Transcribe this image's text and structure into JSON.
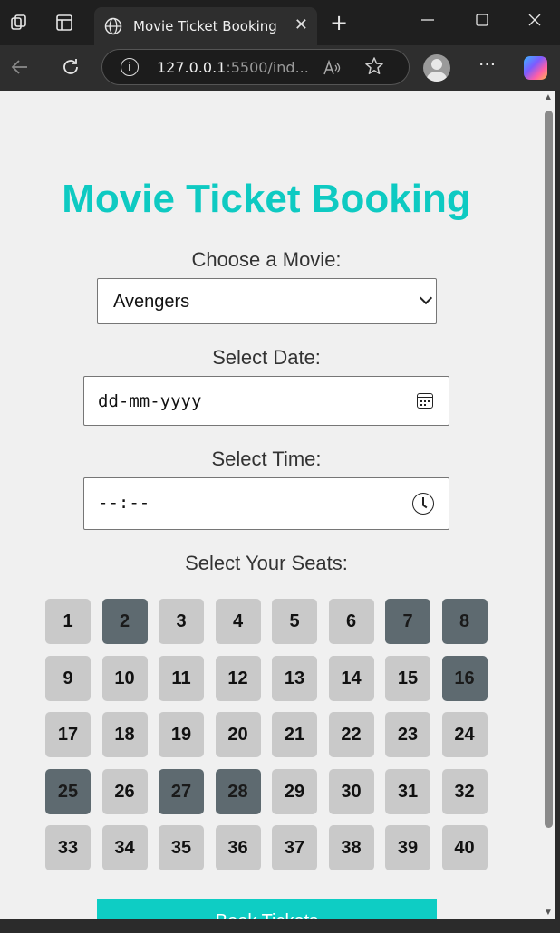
{
  "browser": {
    "tab_title": "Movie Ticket Booking",
    "close_glyph": "✕",
    "new_tab_glyph": "+",
    "url_host": "127.0.0.1",
    "url_path": ":5500/ind...",
    "more_glyph": "···"
  },
  "page": {
    "title": "Movie Ticket Booking",
    "movie_label": "Choose a Movie:",
    "movie_selected": "Avengers",
    "date_label": "Select Date:",
    "date_placeholder": "dd-mm-yyyy",
    "time_label": "Select Time:",
    "time_placeholder": "--:--",
    "seats_label": "Select Your Seats:",
    "book_button": "Book Tickets"
  },
  "seats": [
    {
      "n": "1",
      "occupied": false
    },
    {
      "n": "2",
      "occupied": true
    },
    {
      "n": "3",
      "occupied": false
    },
    {
      "n": "4",
      "occupied": false
    },
    {
      "n": "5",
      "occupied": false
    },
    {
      "n": "6",
      "occupied": false
    },
    {
      "n": "7",
      "occupied": true
    },
    {
      "n": "8",
      "occupied": true
    },
    {
      "n": "9",
      "occupied": false
    },
    {
      "n": "10",
      "occupied": false
    },
    {
      "n": "11",
      "occupied": false
    },
    {
      "n": "12",
      "occupied": false
    },
    {
      "n": "13",
      "occupied": false
    },
    {
      "n": "14",
      "occupied": false
    },
    {
      "n": "15",
      "occupied": false
    },
    {
      "n": "16",
      "occupied": true
    },
    {
      "n": "17",
      "occupied": false
    },
    {
      "n": "18",
      "occupied": false
    },
    {
      "n": "19",
      "occupied": false
    },
    {
      "n": "20",
      "occupied": false
    },
    {
      "n": "21",
      "occupied": false
    },
    {
      "n": "22",
      "occupied": false
    },
    {
      "n": "23",
      "occupied": false
    },
    {
      "n": "24",
      "occupied": false
    },
    {
      "n": "25",
      "occupied": true
    },
    {
      "n": "26",
      "occupied": false
    },
    {
      "n": "27",
      "occupied": true
    },
    {
      "n": "28",
      "occupied": true
    },
    {
      "n": "29",
      "occupied": false
    },
    {
      "n": "30",
      "occupied": false
    },
    {
      "n": "31",
      "occupied": false
    },
    {
      "n": "32",
      "occupied": false
    },
    {
      "n": "33",
      "occupied": false
    },
    {
      "n": "34",
      "occupied": false
    },
    {
      "n": "35",
      "occupied": false
    },
    {
      "n": "36",
      "occupied": false
    },
    {
      "n": "37",
      "occupied": false
    },
    {
      "n": "38",
      "occupied": false
    },
    {
      "n": "39",
      "occupied": false
    },
    {
      "n": "40",
      "occupied": false
    }
  ],
  "colors": {
    "accent": "#0ecac2",
    "seat_available": "#c9c9c9",
    "seat_occupied": "#5e6a70"
  },
  "icons": [
    "workspaces-icon",
    "tab-actions-icon",
    "globe-icon",
    "close-icon",
    "new-tab-icon",
    "minimize-icon",
    "maximize-icon",
    "window-close-icon",
    "back-icon",
    "refresh-icon",
    "info-icon",
    "read-aloud-icon",
    "favorite-star-icon",
    "profile-icon",
    "more-icon",
    "copilot-icon",
    "calendar-icon",
    "clock-icon",
    "chevron-down-icon"
  ]
}
